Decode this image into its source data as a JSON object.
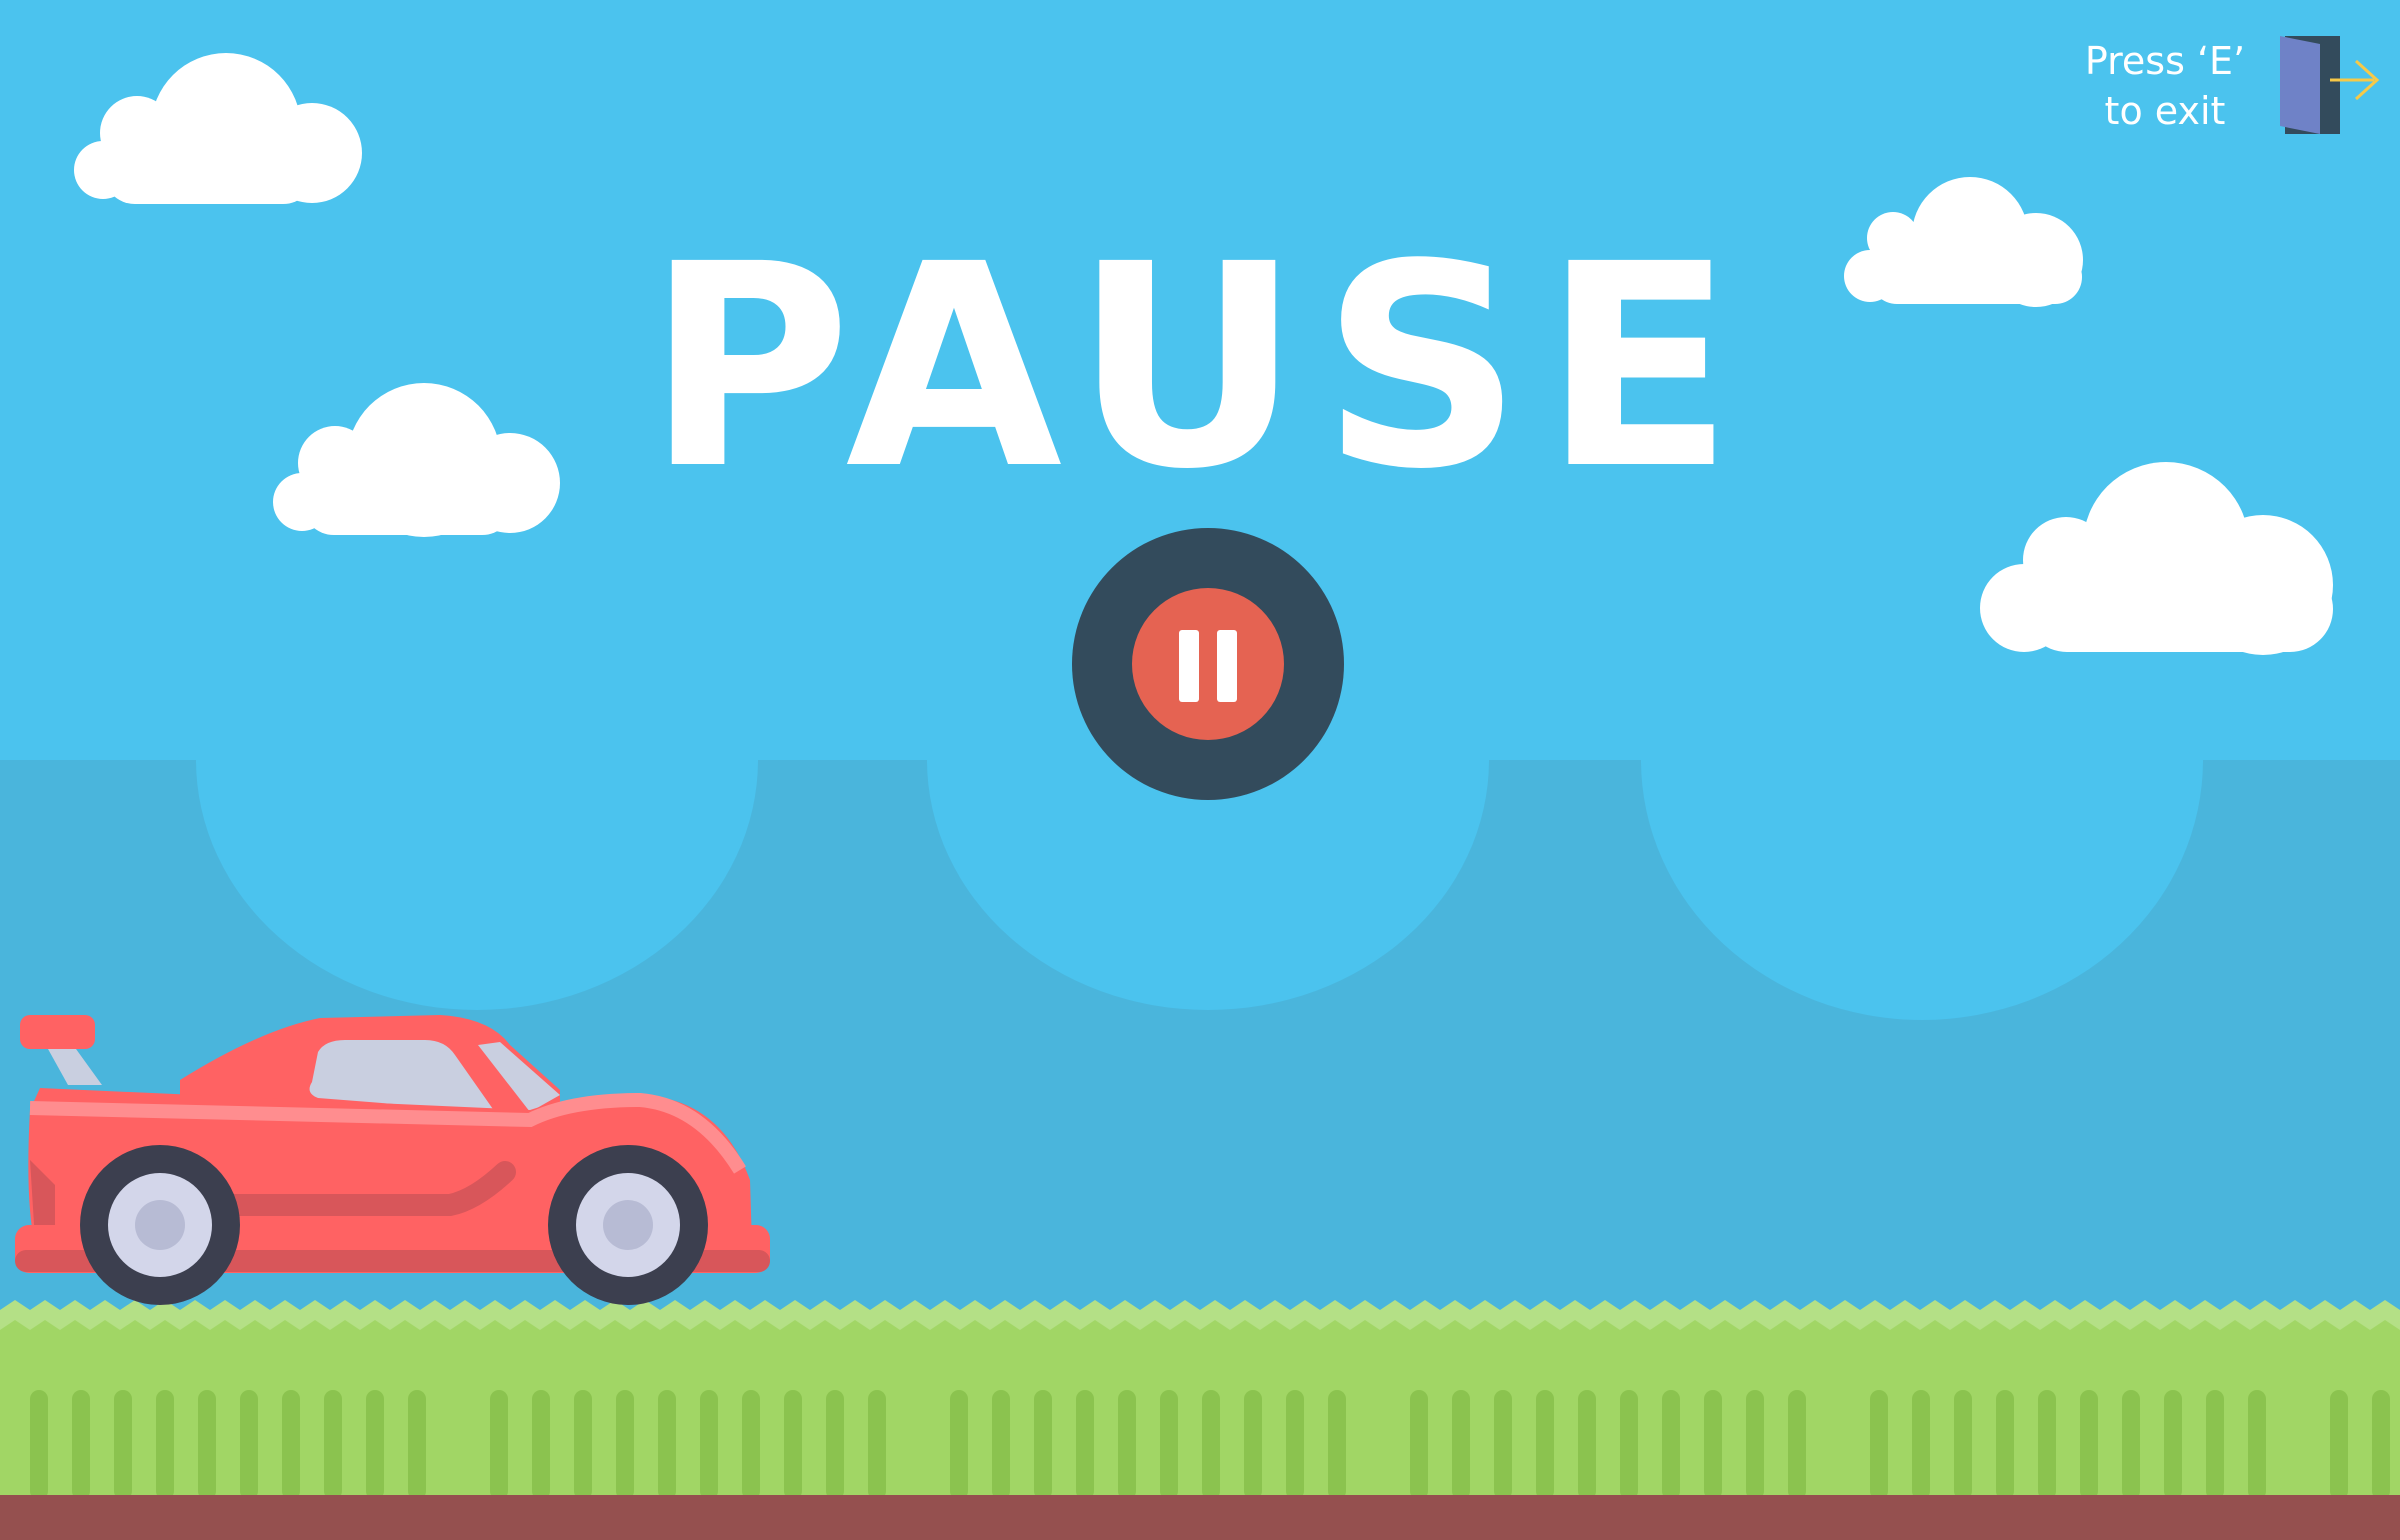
{
  "game": {
    "title": "PAUSE",
    "exit_hint_line1": "Press ‘E’",
    "exit_hint_line2": "to exit",
    "pause_button_icon": "pause-icon",
    "exit_icon": "door-exit-icon"
  },
  "colors": {
    "sky": "#4bc3ee",
    "backdrop_lower": "#4ab5dc",
    "grass_top": "#b4e086",
    "grass": "#a1d665",
    "grass_blades": "#8bc34f",
    "dirt": "#95504f",
    "car_body": "#ff6263",
    "pause_ring": "#334b5c",
    "pause_core": "#e56352"
  }
}
